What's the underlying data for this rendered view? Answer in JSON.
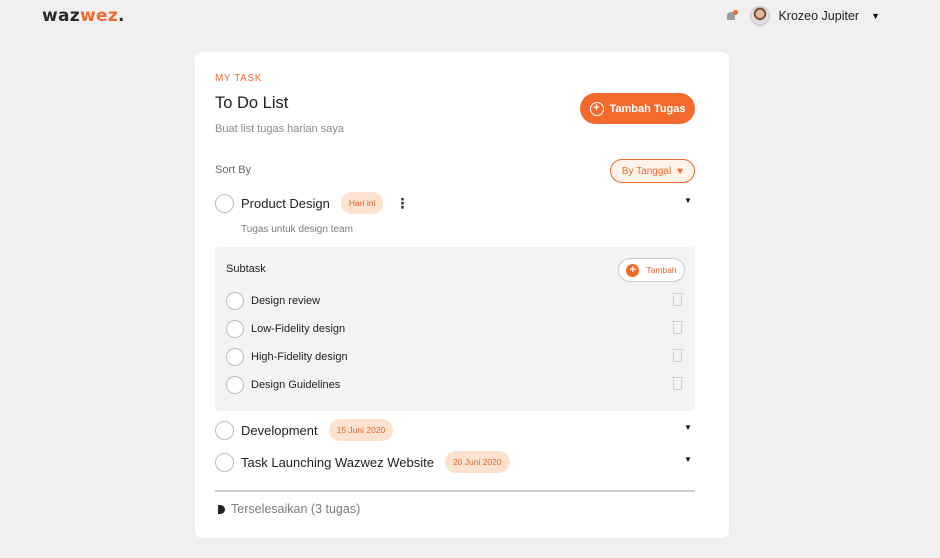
{
  "header": {
    "logo_part1": "waz",
    "logo_part2": "wez",
    "logo_dot": ".",
    "user_name": "Krozeo Jupiter",
    "caret": "▼"
  },
  "card": {
    "eyebrow": "MY TASK",
    "title": "To Do List",
    "subtitle": "Buat list tugas harian saya",
    "add_button_label": "Tambah Tugas",
    "sort_label": "Sort By",
    "sort_button_label": "By Tanggal",
    "sort_icon": "♥"
  },
  "tasks": [
    {
      "name": "Product Design",
      "badge": "Hari ini",
      "menu": "⋮",
      "expand": "▼",
      "description": "Tugas untuk design team"
    },
    {
      "name": "Development",
      "badge": "15 Juni 2020",
      "expand": "▼"
    },
    {
      "name": "Task Launching Wazwez Website",
      "badge": "20 Juni 2020",
      "expand": "▼"
    }
  ],
  "subtask_panel": {
    "title": "Subtask",
    "add_label": "Tambah",
    "add_icon": "+",
    "items": [
      "Design review",
      "Low-Fidelity design",
      "High-Fidelity design",
      "Design Guidelines"
    ]
  },
  "completed": {
    "label": "Terselesaikan (3 tugas)"
  },
  "colors": {
    "accent": "#f26a2e",
    "badge_bg": "#fde2cf",
    "page_bg": "#f0f0f0"
  }
}
